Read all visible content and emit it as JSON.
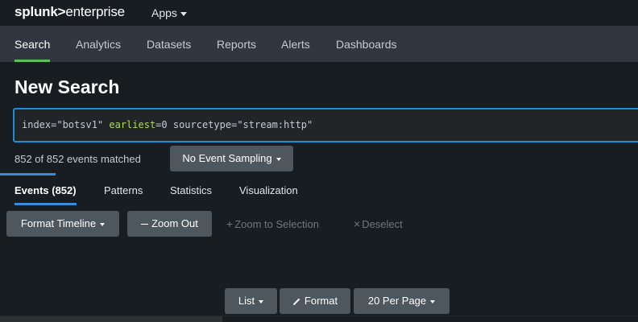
{
  "brand": {
    "part1": "splunk",
    "part2": ">",
    "part3": "enterprise"
  },
  "topbar": {
    "apps_label": "Apps"
  },
  "nav": {
    "tabs": [
      {
        "label": "Search",
        "active": true
      },
      {
        "label": "Analytics"
      },
      {
        "label": "Datasets"
      },
      {
        "label": "Reports"
      },
      {
        "label": "Alerts"
      },
      {
        "label": "Dashboards"
      }
    ]
  },
  "page": {
    "title": "New Search"
  },
  "search": {
    "query": {
      "part1": "index=\"botsv1\" ",
      "keyword": "earliest",
      "part2": "=0 sourcetype=\"stream:http\""
    }
  },
  "results": {
    "match_text": "852 of 852 events matched",
    "sampling_label": "No Event Sampling"
  },
  "subtabs": [
    {
      "label": "Events (852)",
      "active": true
    },
    {
      "label": "Patterns"
    },
    {
      "label": "Statistics"
    },
    {
      "label": "Visualization"
    }
  ],
  "timeline": {
    "format_label": "Format Timeline",
    "zoom_out_label": "Zoom Out",
    "zoom_selection_label": "Zoom to Selection",
    "deselect_label": "Deselect"
  },
  "events_toolbar": {
    "list_label": "List",
    "format_label": "Format",
    "per_page_label": "20 Per Page"
  },
  "colors": {
    "accent_green": "#5cc05c",
    "accent_blue": "#1a8fd6",
    "keyword_green": "#b0da59"
  }
}
